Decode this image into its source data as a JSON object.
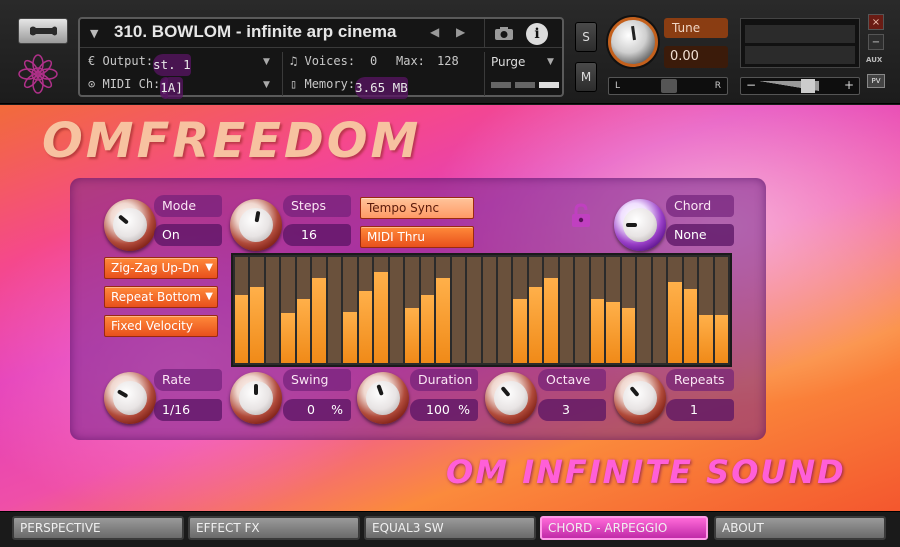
{
  "header": {
    "instrument_name": "310. BOWLOM - infinite arp cinema",
    "output_label": "Output:",
    "output_value": "st. 1",
    "midi_label": "MIDI Ch:",
    "midi_port": "[A]",
    "midi_channel": "1",
    "voices_label": "Voices:",
    "voices_value": "0",
    "max_label": "Max:",
    "max_value": "128",
    "memory_label": "Memory:",
    "memory_value": "3.65 MB",
    "purge_label": "Purge",
    "solo_label": "S",
    "mute_label": "M",
    "tune_label": "Tune",
    "tune_value": "0.00",
    "pan_left": "L",
    "pan_right": "R",
    "vol_minus": "−",
    "vol_plus": "+",
    "aux_label": "AUX",
    "pv_label": "PV",
    "close_label": "×",
    "minimize_label": "−"
  },
  "brand": {
    "title": "OMFREEDOM",
    "footer": "OM INFINITE SOUND"
  },
  "arp": {
    "mode": {
      "label": "Mode",
      "value": "On"
    },
    "steps": {
      "label": "Steps",
      "value": "16"
    },
    "tempo_sync": "Tempo Sync",
    "midi_thru": "MIDI Thru",
    "chord": {
      "label": "Chord",
      "value": "None"
    },
    "direction": "Zig-Zag Up-Dn",
    "repeat_mode": "Repeat Bottom",
    "velocity_mode": "Fixed Velocity",
    "rate": {
      "label": "Rate",
      "value": "1/16"
    },
    "swing": {
      "label": "Swing",
      "value": "0",
      "unit": "%"
    },
    "duration": {
      "label": "Duration",
      "value": "100",
      "unit": "%"
    },
    "octave": {
      "label": "Octave",
      "value": "3"
    },
    "repeats": {
      "label": "Repeats",
      "value": "1"
    },
    "step_levels": [
      0.64,
      0.72,
      0.0,
      0.47,
      0.6,
      0.8,
      0.0,
      0.48,
      0.68,
      0.86,
      0.0,
      0.52,
      0.64,
      0.8,
      0.0,
      0.0,
      0.0,
      0.0,
      0.6,
      0.72,
      0.8,
      0.0,
      0.0,
      0.6,
      0.58,
      0.52,
      0.0,
      0.0,
      0.76,
      0.7,
      0.45,
      0.45
    ]
  },
  "tabs": [
    {
      "label": "PERSPECTIVE"
    },
    {
      "label": "EFFECT FX"
    },
    {
      "label": "EQUAL3 SW"
    },
    {
      "label": "CHORD - ARPEGGIO"
    },
    {
      "label": "ABOUT"
    }
  ],
  "colors": {
    "active_tab": "#e040c0",
    "step_bar": "#f7a02e",
    "step_bg": "#6a513c"
  }
}
